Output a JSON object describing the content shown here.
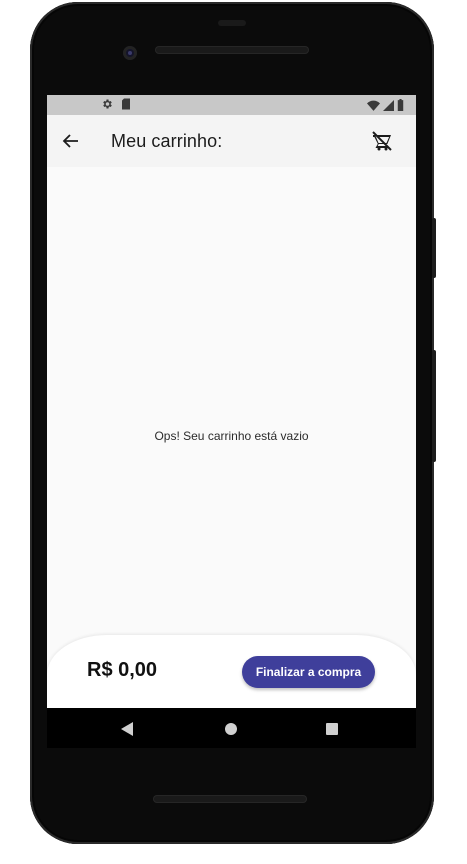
{
  "app_bar": {
    "title": "Meu carrinho:",
    "back_icon": "arrow-left-icon",
    "clear_cart_icon": "remove-shopping-cart-icon"
  },
  "status_bar": {
    "left_icons": [
      "gear-icon",
      "sd-card-icon"
    ],
    "right_icons": [
      "wifi-icon",
      "signal-icon",
      "battery-icon"
    ]
  },
  "cart": {
    "empty_message": "Ops! Seu carrinho está vazio"
  },
  "footer": {
    "total": "R$ 0,00",
    "checkout_label": "Finalizar a compra"
  },
  "nav_bar": {
    "icons": [
      "nav-back-icon",
      "nav-home-icon",
      "nav-recents-icon"
    ]
  },
  "colors": {
    "accent": "#3f3f9b",
    "app_bar_bg": "#f4f4f4",
    "content_bg": "#fafafa",
    "status_bar_bg": "#c8c8c8"
  }
}
